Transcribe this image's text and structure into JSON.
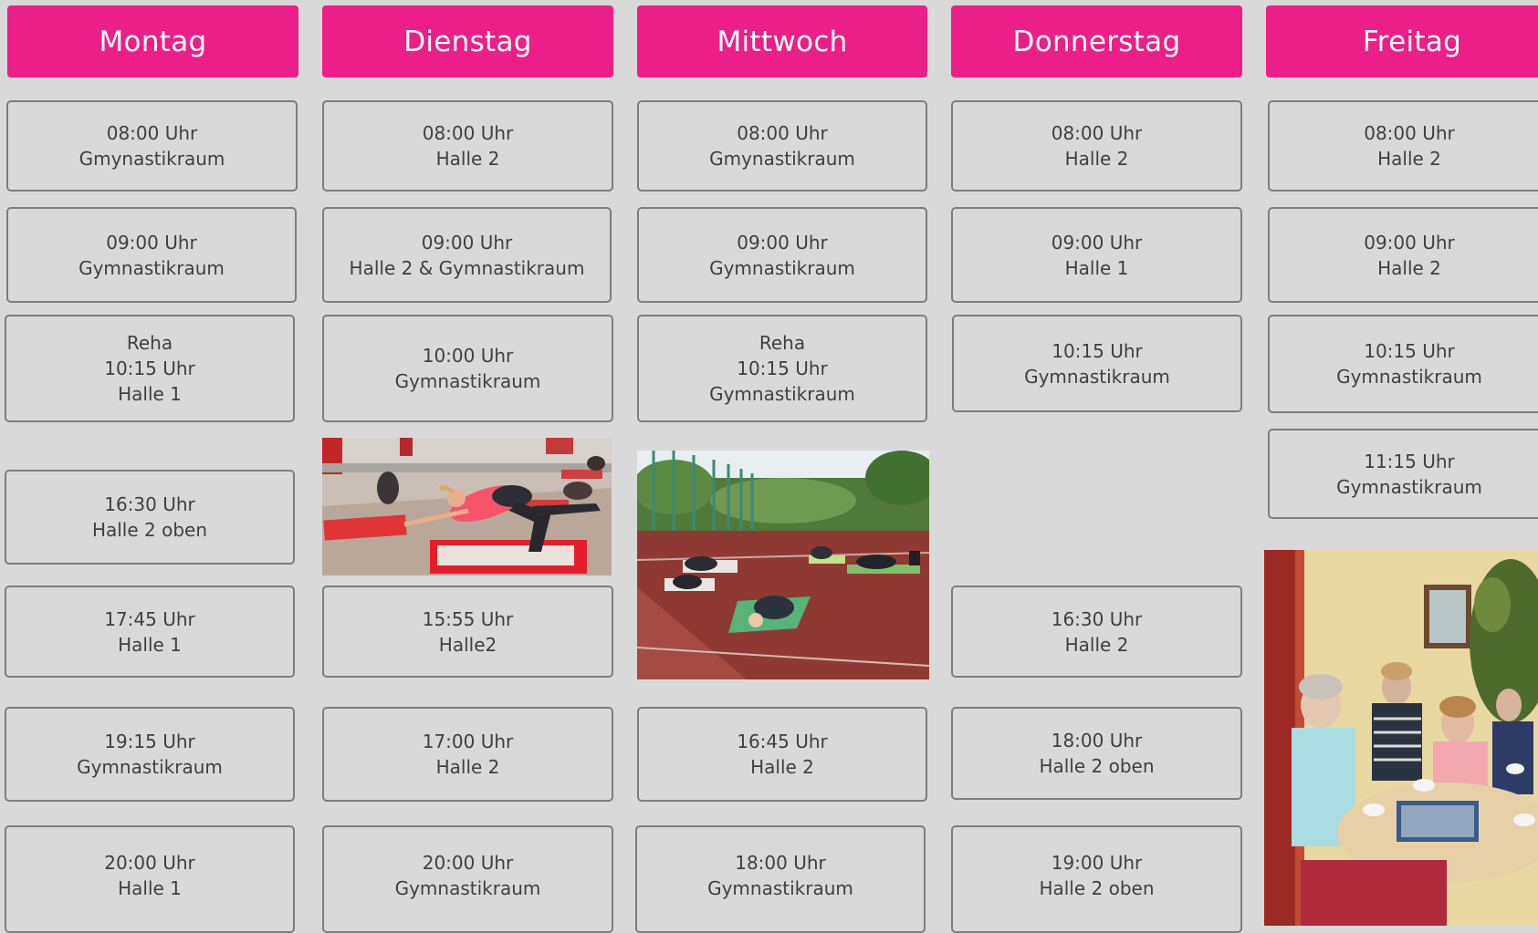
{
  "days": [
    "Montag",
    "Dienstag",
    "Mittwoch",
    "Donnerstag",
    "Freitag"
  ],
  "sessions": {
    "montag": [
      {
        "time": "08:00 Uhr",
        "room": "Gmynastikraum"
      },
      {
        "time": "09:00 Uhr",
        "room": "Gymnastikraum"
      },
      {
        "title": "Reha",
        "time": "10:15 Uhr",
        "room": "Halle 1"
      },
      {
        "time": "16:30 Uhr",
        "room": "Halle 2 oben"
      },
      {
        "time": "17:45 Uhr",
        "room": "Halle 1"
      },
      {
        "time": "19:15 Uhr",
        "room": "Gymnastikraum"
      },
      {
        "time": "20:00 Uhr",
        "room": "Halle 1"
      }
    ],
    "dienstag": [
      {
        "time": "08:00 Uhr",
        "room": "Halle 2"
      },
      {
        "time": "09:00 Uhr",
        "room": "Halle 2 & Gymnastikraum"
      },
      {
        "time": "10:00 Uhr",
        "room": "Gymnastikraum"
      },
      {
        "time": "15:55 Uhr",
        "room": "Halle2"
      },
      {
        "time": "17:00 Uhr",
        "room": "Halle 2"
      },
      {
        "time": "20:00 Uhr",
        "room": "Gymnastikraum"
      }
    ],
    "mittwoch": [
      {
        "time": "08:00 Uhr",
        "room": "Gmynastikraum"
      },
      {
        "time": "09:00 Uhr",
        "room": "Gymnastikraum"
      },
      {
        "title": "Reha",
        "time": "10:15 Uhr",
        "room": "Gymnastikraum"
      },
      {
        "time": "16:45 Uhr",
        "room": "Halle 2"
      },
      {
        "time": "18:00 Uhr",
        "room": "Gymnastikraum"
      }
    ],
    "donnerstag": [
      {
        "time": "08:00 Uhr",
        "room": "Halle 2"
      },
      {
        "time": "09:00 Uhr",
        "room": "Halle 1"
      },
      {
        "time": "10:15 Uhr",
        "room": "Gymnastikraum"
      },
      {
        "time": "16:30 Uhr",
        "room": "Halle 2"
      },
      {
        "time": "18:00 Uhr",
        "room": "Halle 2 oben"
      },
      {
        "time": "19:00 Uhr",
        "room": "Halle 2 oben"
      }
    ],
    "freitag": [
      {
        "time": "08:00 Uhr",
        "room": "Halle 2"
      },
      {
        "time": "09:00 Uhr",
        "room": "Halle 2"
      },
      {
        "time": "10:15 Uhr",
        "room": "Gymnastikraum"
      },
      {
        "time": "11:15 Uhr",
        "room": "Gymnastikraum"
      }
    ]
  },
  "colors": {
    "header": "#eb1f87",
    "background": "#d9d9d9",
    "card_border": "#7d7d7d"
  }
}
